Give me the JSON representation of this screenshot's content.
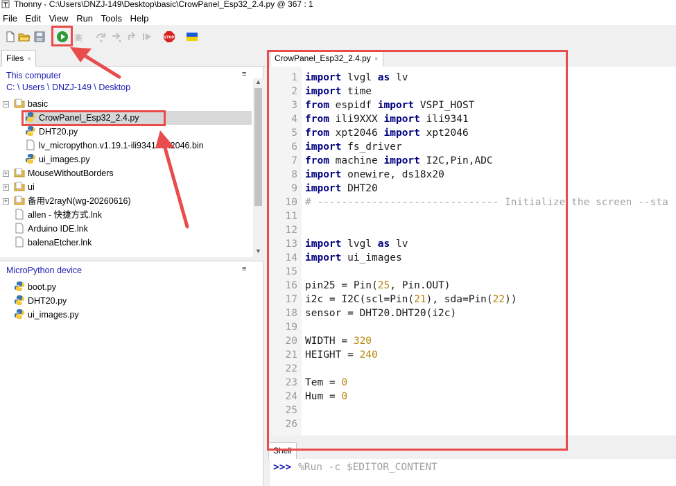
{
  "window": {
    "title": "Thonny  -  C:\\Users\\DNZJ-149\\Desktop\\basic\\CrowPanel_Esp32_2.4.py  @  367 : 1"
  },
  "menu": [
    "File",
    "Edit",
    "View",
    "Run",
    "Tools",
    "Help"
  ],
  "toolbar": [
    "new-icon",
    "open-icon",
    "save-icon",
    "run-icon",
    "debug-icon",
    "step-over-icon",
    "step-into-icon",
    "step-out-icon",
    "resume-icon",
    "stop-icon",
    "ukraine-flag-icon"
  ],
  "files": {
    "tab_label": "Files",
    "computer": {
      "title": "This computer",
      "path": "C: \\ Users \\ DNZJ-149 \\ Desktop",
      "items": [
        {
          "label": "basic",
          "type": "folder",
          "expanded": true
        },
        {
          "label": "CrowPanel_Esp32_2.4.py",
          "type": "py",
          "selected": true
        },
        {
          "label": "DHT20.py",
          "type": "py"
        },
        {
          "label": "lv_micropython.v1.19.1-ili9341-xpt2046.bin",
          "type": "file"
        },
        {
          "label": "ui_images.py",
          "type": "py"
        },
        {
          "label": "MouseWithoutBorders",
          "type": "folder"
        },
        {
          "label": "ui",
          "type": "folder"
        },
        {
          "label": "备用v2rayN(wg-20260616)",
          "type": "folder"
        },
        {
          "label": "allen - 快捷方式.lnk",
          "type": "file"
        },
        {
          "label": "Arduino IDE.lnk",
          "type": "file"
        },
        {
          "label": "balenaEtcher.lnk",
          "type": "file"
        }
      ]
    },
    "device": {
      "title": "MicroPython device",
      "items": [
        {
          "label": "boot.py"
        },
        {
          "label": "DHT20.py"
        },
        {
          "label": "ui_images.py"
        }
      ]
    }
  },
  "editor": {
    "tab_label": "CrowPanel_Esp32_2.4.py",
    "lines": [
      [
        [
          "kw",
          "import"
        ],
        [
          "t",
          " lvgl "
        ],
        [
          "kw",
          "as"
        ],
        [
          "t",
          " lv"
        ]
      ],
      [
        [
          "kw",
          "import"
        ],
        [
          "t",
          " time"
        ]
      ],
      [
        [
          "kw",
          "from"
        ],
        [
          "t",
          " espidf "
        ],
        [
          "kw",
          "import"
        ],
        [
          "t",
          " VSPI_HOST"
        ]
      ],
      [
        [
          "kw",
          "from"
        ],
        [
          "t",
          " ili9XXX "
        ],
        [
          "kw",
          "import"
        ],
        [
          "t",
          " ili9341"
        ]
      ],
      [
        [
          "kw",
          "from"
        ],
        [
          "t",
          " xpt2046 "
        ],
        [
          "kw",
          "import"
        ],
        [
          "t",
          " xpt2046"
        ]
      ],
      [
        [
          "kw",
          "import"
        ],
        [
          "t",
          " fs_driver"
        ]
      ],
      [
        [
          "kw",
          "from"
        ],
        [
          "t",
          " machine "
        ],
        [
          "kw",
          "import"
        ],
        [
          "t",
          " I2C,Pin,ADC"
        ]
      ],
      [
        [
          "kw",
          "import"
        ],
        [
          "t",
          " onewire, ds18x20"
        ]
      ],
      [
        [
          "kw",
          "import"
        ],
        [
          "t",
          " DHT20"
        ]
      ],
      [
        [
          "cm",
          "# ------------------------------ Initialize the screen --sta"
        ]
      ],
      [],
      [],
      [
        [
          "kw",
          "import"
        ],
        [
          "t",
          " lvgl "
        ],
        [
          "kw",
          "as"
        ],
        [
          "t",
          " lv"
        ]
      ],
      [
        [
          "kw",
          "import"
        ],
        [
          "t",
          " ui_images"
        ]
      ],
      [],
      [
        [
          "t",
          "pin25 = Pin("
        ],
        [
          "num",
          "25"
        ],
        [
          "t",
          ", Pin.OUT)"
        ]
      ],
      [
        [
          "t",
          "i2c = I2C(scl=Pin("
        ],
        [
          "num",
          "21"
        ],
        [
          "t",
          "), sda=Pin("
        ],
        [
          "num",
          "22"
        ],
        [
          "t",
          "))"
        ]
      ],
      [
        [
          "t",
          "sensor = DHT20.DHT20(i2c)"
        ]
      ],
      [],
      [
        [
          "t",
          "WIDTH = "
        ],
        [
          "num",
          "320"
        ]
      ],
      [
        [
          "t",
          "HEIGHT = "
        ],
        [
          "num",
          "240"
        ]
      ],
      [],
      [
        [
          "t",
          "Tem = "
        ],
        [
          "num",
          "0"
        ]
      ],
      [
        [
          "t",
          "Hum = "
        ],
        [
          "num",
          "0"
        ]
      ],
      [],
      []
    ]
  },
  "shell": {
    "tab_label": "Shell",
    "prompt": ">>>",
    "command": "%Run -c $EDITOR_CONTENT"
  },
  "colors": {
    "highlight": "#e84c4c",
    "keyword": "#000080",
    "number": "#b8860b",
    "link": "#1a1ab0"
  }
}
